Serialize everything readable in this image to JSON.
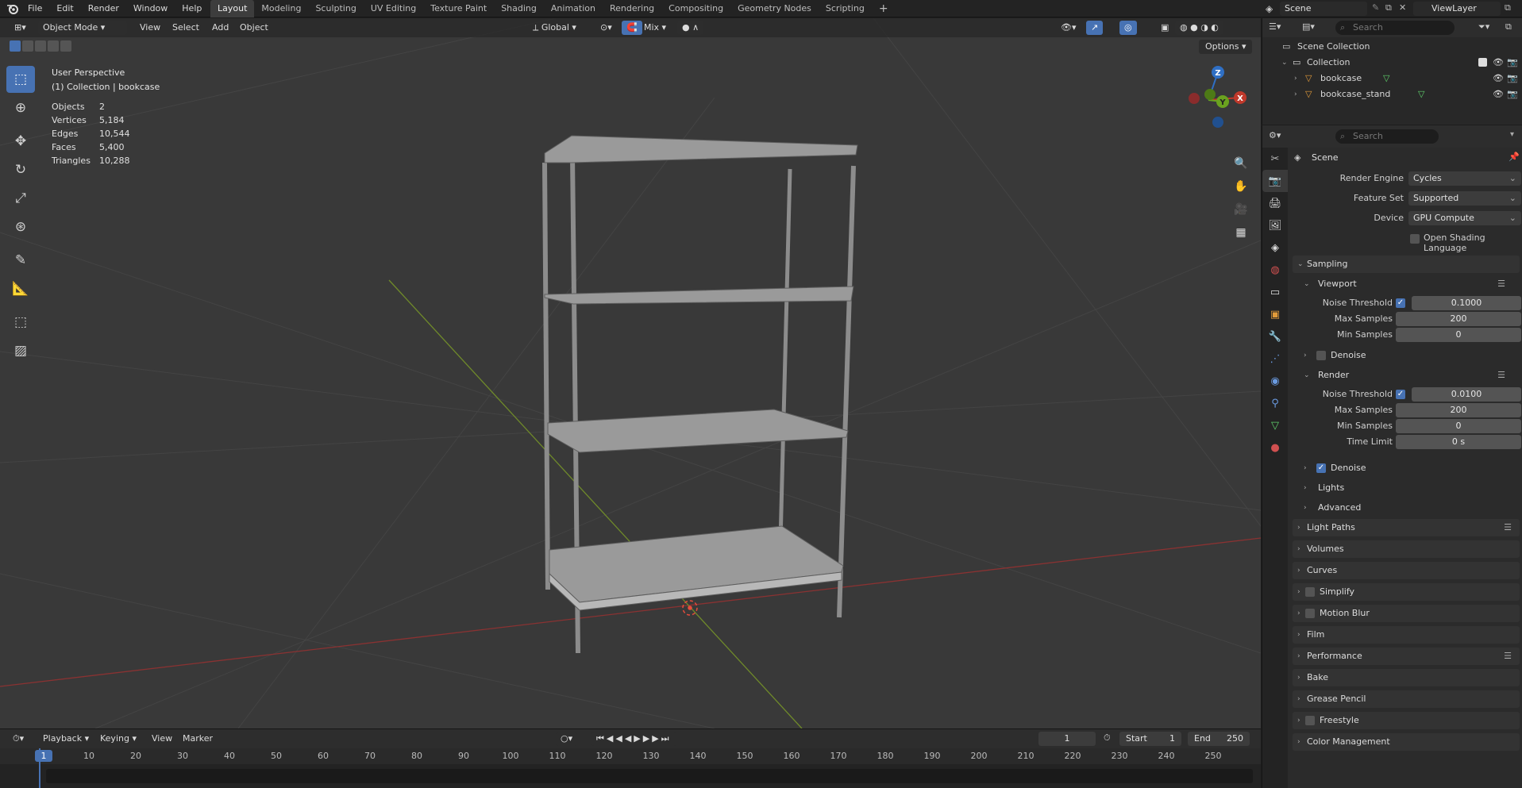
{
  "topbar": {
    "menu": [
      "File",
      "Edit",
      "Render",
      "Window",
      "Help"
    ],
    "workspaces": [
      "Layout",
      "Modeling",
      "Sculpting",
      "UV Editing",
      "Texture Paint",
      "Shading",
      "Animation",
      "Rendering",
      "Compositing",
      "Geometry Nodes",
      "Scripting"
    ],
    "active_workspace": "Layout",
    "add_tab": "+",
    "scene": "Scene",
    "view_layer": "ViewLayer"
  },
  "viewport": {
    "mode": "Object Mode",
    "menu": [
      "View",
      "Select",
      "Add",
      "Object"
    ],
    "transform_orientation": "Global",
    "snap_target": "Mix",
    "options_label": "Options",
    "perspective": "User Perspective",
    "context": "(1) Collection | bookcase",
    "stats": [
      {
        "label": "Objects",
        "value": "2"
      },
      {
        "label": "Vertices",
        "value": "5,184"
      },
      {
        "label": "Edges",
        "value": "10,544"
      },
      {
        "label": "Faces",
        "value": "5,400"
      },
      {
        "label": "Triangles",
        "value": "10,288"
      }
    ],
    "gizmo": {
      "x": "X",
      "y": "Y",
      "z": "Z"
    }
  },
  "outliner": {
    "search_placeholder": "Search",
    "root": "Scene Collection",
    "collection": "Collection",
    "objects": [
      "bookcase",
      "bookcase_stand"
    ]
  },
  "properties": {
    "search_placeholder": "Search",
    "context": "Scene",
    "render_engine_label": "Render Engine",
    "render_engine": "Cycles",
    "feature_set_label": "Feature Set",
    "feature_set": "Supported",
    "device_label": "Device",
    "device": "GPU Compute",
    "osl_label": "Open Shading Language",
    "sampling": "Sampling",
    "viewport": "Viewport",
    "noise_threshold_label": "Noise Threshold",
    "viewport_noise_threshold": "0.1000",
    "max_samples_label": "Max Samples",
    "viewport_max_samples": "200",
    "min_samples_label": "Min Samples",
    "viewport_min_samples": "0",
    "denoise_label": "Denoise",
    "render": "Render",
    "render_noise_threshold": "0.0100",
    "render_max_samples": "200",
    "render_min_samples": "0",
    "time_limit_label": "Time Limit",
    "render_time_limit": "0 s",
    "lights": "Lights",
    "advanced": "Advanced",
    "panels": [
      "Light Paths",
      "Volumes",
      "Curves",
      "Simplify",
      "Motion Blur",
      "Film",
      "Performance",
      "Bake",
      "Grease Pencil",
      "Freestyle",
      "Color Management"
    ]
  },
  "timeline": {
    "menu": [
      "Playback",
      "Keying",
      "View",
      "Marker"
    ],
    "current_frame": "1",
    "start_label": "Start",
    "start": "1",
    "end_label": "End",
    "end": "250",
    "ticks": [
      "1",
      "10",
      "20",
      "30",
      "40",
      "50",
      "60",
      "70",
      "80",
      "90",
      "100",
      "110",
      "120",
      "130",
      "140",
      "150",
      "160",
      "170",
      "180",
      "190",
      "200",
      "210",
      "220",
      "230",
      "240",
      "250"
    ]
  },
  "colors": {
    "accent": "#4772b3",
    "x_axis": "#c0392b",
    "y_axis": "#7a9a2a"
  }
}
